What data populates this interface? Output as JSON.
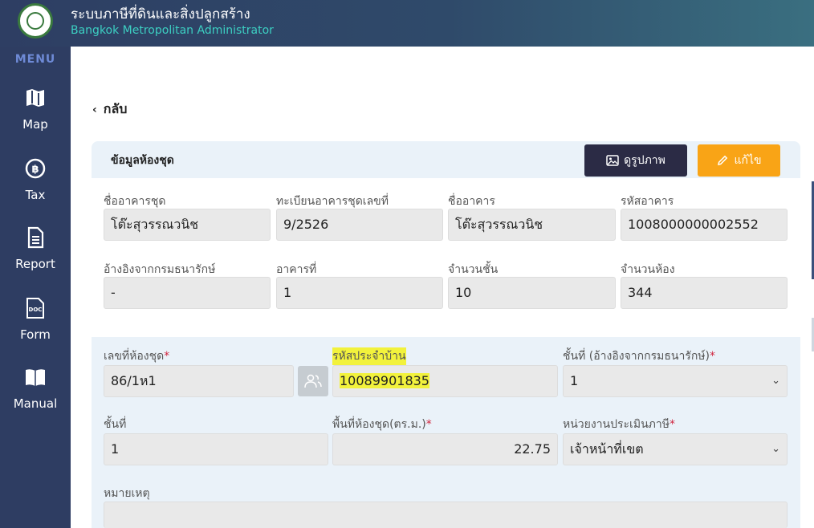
{
  "header": {
    "title": "ระบบภาษีที่ดินและสิ่งปลูกสร้าง",
    "subtitle": "Bangkok Metropolitan Administrator"
  },
  "sidebar": {
    "menu_label": "MENU",
    "items": [
      {
        "label": "Map",
        "icon": "map-icon"
      },
      {
        "label": "Tax",
        "icon": "baht-coin-icon"
      },
      {
        "label": "Report",
        "icon": "document-icon"
      },
      {
        "label": "Form",
        "icon": "doc-file-icon"
      },
      {
        "label": "Manual",
        "icon": "book-icon"
      }
    ]
  },
  "back": {
    "label": "กลับ"
  },
  "panel": {
    "title": "ข้อมูลห้องชุด",
    "view_button": "ดูรูปภาพ",
    "edit_button": "แก้ไข"
  },
  "building": {
    "name_label": "ชื่ออาคารชุด",
    "name_value": "โต๊ะสุวรรณวนิช",
    "reg_label": "ทะเบียนอาคารชุดเลขที่",
    "reg_value": "9/2526",
    "bname_label": "ชื่ออาคาร",
    "bname_value": "โต๊ะสุวรรณวนิช",
    "code_label": "รหัสอาคาร",
    "code_value": "1008000000002552",
    "ref_label": "อ้างอิงจากกรมธนารักษ์",
    "ref_value": "-",
    "bno_label": "อาคารที่",
    "bno_value": "1",
    "floors_label": "จำนวนชั้น",
    "floors_value": "10",
    "rooms_label": "จำนวนห้อง",
    "rooms_value": "344"
  },
  "unit": {
    "no_label": "เลขที่ห้องชุด",
    "no_value": "86/1ห1",
    "house_label": "รหัสประจำบ้าน",
    "house_value": "10089901835",
    "floor_ref_label": "ชั้นที่ (อ้างอิงจากกรมธนารักษ์)",
    "floor_ref_value": "1",
    "floor_label": "ชั้นที่",
    "floor_value": "1",
    "area_label": "พื้นที่ห้องชุด(ตร.ม.)",
    "area_value": "22.75",
    "agency_label": "หน่วยงานประเมินภาษี",
    "agency_value": "เจ้าหน้าที่เขต",
    "note_label": "หมายเหตุ",
    "note_value": ""
  },
  "required_mark": "*",
  "colors": {
    "sidebar": "#2e3d62",
    "view_button": "#2b2b45",
    "edit_button": "#f9a416",
    "highlight": "#f2f23c",
    "panel_bg": "#eaf2f9"
  }
}
